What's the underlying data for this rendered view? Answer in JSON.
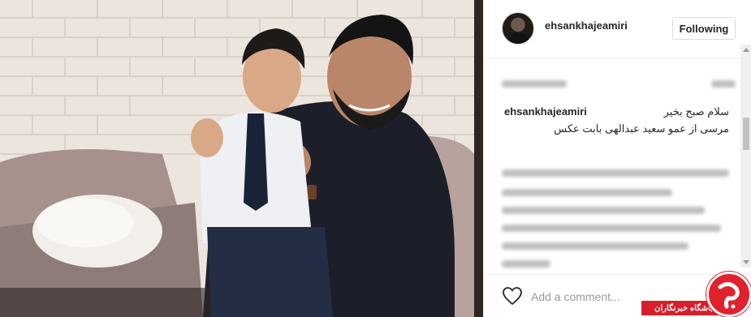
{
  "post": {
    "username": "ehsankhajeamiri",
    "follow_label": "Following"
  },
  "caption": {
    "username": "ehsankhajeamiri",
    "line1": "سلام صبح بخیر",
    "line2": "مرسی از عمو سعید عبدالهی بابت عکس"
  },
  "comment_box": {
    "placeholder": "Add a comment..."
  },
  "icons": [
    "heart-icon",
    "scroll-up-icon",
    "scroll-down-icon"
  ],
  "colors": {
    "text": "#262626",
    "border": "#dbdbdb",
    "placeholder": "#999999",
    "watermark_red": "#e0212e"
  },
  "watermark": {
    "text": "باشگاه خبرنگاران"
  }
}
